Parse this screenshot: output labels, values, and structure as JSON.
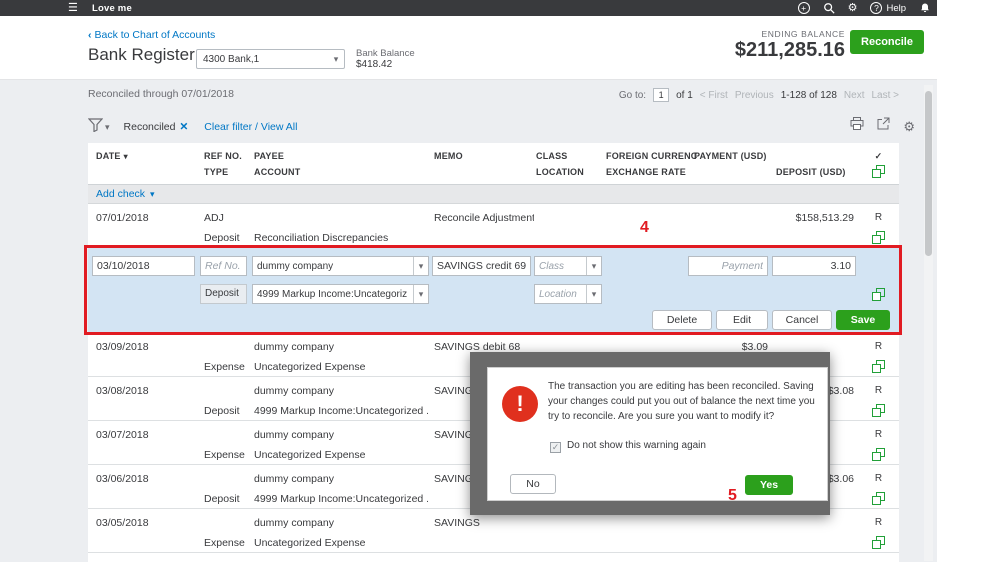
{
  "topbar": {
    "app_name": "Love me",
    "help_label": "Help"
  },
  "header": {
    "back_link": "Back to Chart of Accounts",
    "title": "Bank Register",
    "account_dropdown": "4300 Bank,1",
    "bank_balance_label": "Bank Balance",
    "bank_balance_value": "$418.42",
    "ending_balance_label": "ENDING BALANCE",
    "ending_balance_value": "$211,285.16",
    "reconcile_button": "Reconcile"
  },
  "toolbar": {
    "reconciled_through": "Reconciled through 07/01/2018",
    "goto_label": "Go to:",
    "page_value": "1",
    "page_of": "of 1",
    "first_link": "< First",
    "prev_link": "Previous",
    "range_text": "1-128 of 128",
    "next_link": "Next",
    "last_link": "Last >"
  },
  "filterbar": {
    "filter_chip": "Reconciled",
    "clear_link": "Clear filter / View All"
  },
  "table": {
    "headers": {
      "date": "DATE",
      "ref": "REF NO.",
      "type": "TYPE",
      "payee": "PAYEE",
      "account": "ACCOUNT",
      "memo": "MEMO",
      "class": "CLASS",
      "location": "LOCATION",
      "foreign": "FOREIGN CURRENC",
      "exchange": "EXCHANGE RATE",
      "payment": "PAYMENT (USD)",
      "deposit": "DEPOSIT (USD)"
    },
    "add_check_label": "Add check",
    "rows": [
      {
        "date": "07/01/2018",
        "ref": "ADJ",
        "type": "Deposit",
        "payee": "",
        "account": "Reconciliation Discrepancies",
        "memo": "Reconcile Adjustment",
        "payment": "",
        "deposit": "$158,513.29",
        "status": "R"
      },
      {
        "date": "03/09/2018",
        "ref": "",
        "type": "Expense",
        "payee": "dummy company",
        "account": "Uncategorized Expense",
        "memo": "SAVINGS debit 68",
        "payment": "$3.09",
        "deposit": "",
        "status": "R"
      },
      {
        "date": "03/08/2018",
        "ref": "",
        "type": "Deposit",
        "payee": "dummy company",
        "account": "4999 Markup Income:Uncategorized ...",
        "memo": "SAVINGS",
        "payment": "",
        "deposit": "$3.08",
        "status": "R"
      },
      {
        "date": "03/07/2018",
        "ref": "",
        "type": "Expense",
        "payee": "dummy company",
        "account": "Uncategorized Expense",
        "memo": "SAVINGS",
        "payment": "",
        "deposit": "",
        "status": "R"
      },
      {
        "date": "03/06/2018",
        "ref": "",
        "type": "Deposit",
        "payee": "dummy company",
        "account": "4999 Markup Income:Uncategorized ...",
        "memo": "SAVINGS",
        "payment": "",
        "deposit": "$3.06",
        "status": "R"
      },
      {
        "date": "03/05/2018",
        "ref": "",
        "type": "Expense",
        "payee": "dummy company",
        "account": "Uncategorized Expense",
        "memo": "SAVINGS",
        "payment": "",
        "deposit": "",
        "status": "R"
      }
    ]
  },
  "edit_row": {
    "date_value": "03/10/2018",
    "ref_placeholder": "Ref No.",
    "payee_value": "dummy company",
    "memo_value": "SAVINGS credit 69",
    "class_placeholder": "Class",
    "payment_placeholder": "Payment",
    "deposit_value": "3.10",
    "type_value": "Deposit",
    "account_value": "4999 Markup Income:Uncategoriz",
    "location_placeholder": "Location",
    "delete_button": "Delete",
    "edit_button": "Edit",
    "cancel_button": "Cancel",
    "save_button": "Save"
  },
  "modal": {
    "message": "The transaction you are editing has been reconciled. Saving your changes could put you out of balance the next time you try to reconcile. Are you sure you want to modify it?",
    "checkbox_label": "Do not show this warning again",
    "no_button": "No",
    "yes_button": "Yes"
  },
  "annotations": {
    "step4": "4",
    "step5": "5"
  },
  "icons": {
    "hamburger": "☰",
    "gear": "⚙",
    "help_q": "?",
    "plus": "+",
    "caret_down": "▾",
    "chevron_left": "‹",
    "close": "✕",
    "check": "✓",
    "exclaim": "!"
  },
  "colors": {
    "brand_green": "#2ca01c",
    "link_blue": "#0077c5",
    "annotation_red": "#e11b22",
    "topbar_bg": "#393a3d",
    "warning_red": "#e0301e"
  }
}
